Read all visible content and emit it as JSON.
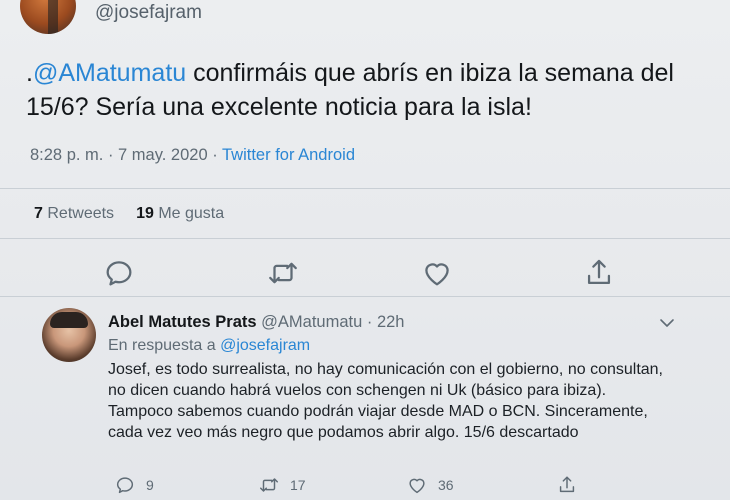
{
  "top": {
    "handle": "@josefajram"
  },
  "tweet": {
    "mention": "@AMatumatu",
    "lead_char": ".",
    "text_line_rest": " confirmáis que abrís en ibiza la semana del 15/6? Sería una excelente noticia para la isla!",
    "time": "8:28 p. m.",
    "sep": " · ",
    "date": "7 may. 2020",
    "source": "Twitter for Android"
  },
  "stats": {
    "retweets_count": "7",
    "retweets_label": "Retweets",
    "likes_count": "19",
    "likes_label": "Me gusta"
  },
  "actions": [
    "reply-icon",
    "retweet-icon",
    "like-icon",
    "share-icon"
  ],
  "reply": {
    "name": "Abel Matutes Prats",
    "handle": "@AMatumatu",
    "dot": " · ",
    "time": "22h",
    "in_reply_prefix": "En respuesta a",
    "in_reply_handle": "@josefajram",
    "body": "Josef, es todo surrealista, no hay comunicación con el gobierno, no consultan, no dicen cuando habrá vuelos con schengen ni Uk (básico para ibiza). Tampoco sabemos cuando podrán viajar desde MAD o BCN. Sinceramente, cada vez veo más negro que podamos abrir algo. 15/6 descartado",
    "replies": "9",
    "retweets": "17",
    "likes": "36"
  },
  "colors": {
    "link": "#2a86d4",
    "muted": "#5f6b75",
    "text": "#14171a"
  }
}
